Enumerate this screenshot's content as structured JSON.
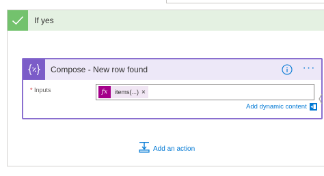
{
  "branch": {
    "title": "If yes",
    "accent_color": "#73c26d"
  },
  "card": {
    "title": "Compose - New row found",
    "accent_color": "#7b5cc8",
    "icon": "compose-braces-icon",
    "inputs_required_marker": "*",
    "inputs_label": "Inputs",
    "token": {
      "icon_text": "fx",
      "text": "items(...)",
      "remove_glyph": "×"
    },
    "dynamic_content_link": "Add dynamic content"
  },
  "footer": {
    "add_action_label": "Add an action"
  },
  "colors": {
    "link": "#0078d4",
    "expression": "#a4008a"
  }
}
